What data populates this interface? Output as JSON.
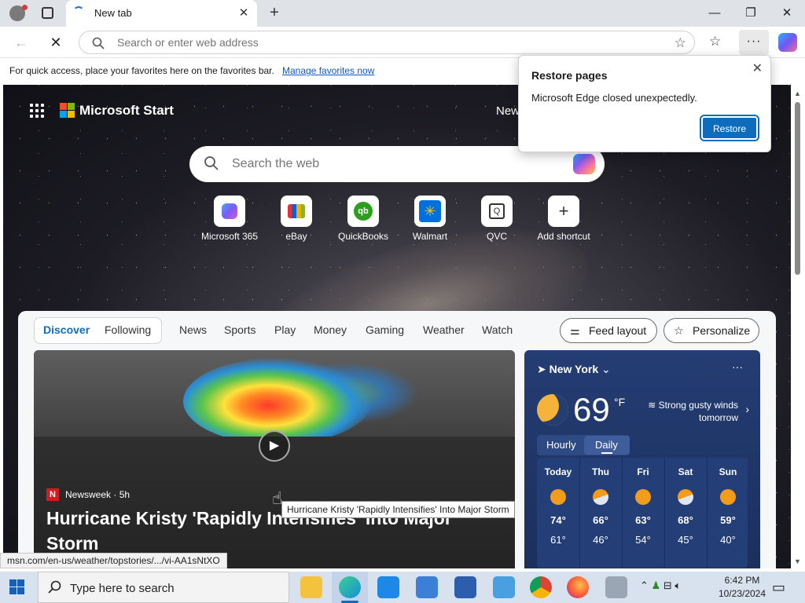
{
  "browser": {
    "tab_title": "New tab",
    "address_placeholder": "Search or enter web address",
    "favorites_hint": "For quick access, place your favorites here on the favorites bar.",
    "favorites_link": "Manage favorites now"
  },
  "start": {
    "brand": "Microsoft Start",
    "nav_partial": "New",
    "search_placeholder": "Search the web",
    "shortcuts": [
      {
        "label": "Microsoft 365",
        "icon": "microsoft-365-icon",
        "color": "#7b5cf5"
      },
      {
        "label": "eBay",
        "icon": "ebay-icon",
        "color": "#e53238"
      },
      {
        "label": "QuickBooks",
        "icon": "quickbooks-icon",
        "color": "#2ca01c"
      },
      {
        "label": "Walmart",
        "icon": "walmart-icon",
        "color": "#0071dc"
      },
      {
        "label": "QVC",
        "icon": "qvc-icon",
        "color": "#333333"
      },
      {
        "label": "Add shortcut",
        "icon": "plus-icon",
        "color": "#555555"
      }
    ]
  },
  "feed": {
    "tabs": [
      "Discover",
      "Following",
      "News",
      "Sports",
      "Play",
      "Money",
      "Gaming",
      "Weather",
      "Watch"
    ],
    "feed_layout_label": "Feed layout",
    "personalize_label": "Personalize",
    "hero": {
      "source": "Newsweek",
      "age": "· 5h",
      "headline": "Hurricane Kristy 'Rapidly Intensifies' Into Major Storm"
    }
  },
  "weather": {
    "location": "New York",
    "temperature": "69",
    "unit": "°F",
    "condition": "Strong gusty winds tomorrow",
    "tab_hourly": "Hourly",
    "tab_daily": "Daily",
    "days": [
      {
        "day": "Today",
        "hi": "74°",
        "lo": "61°",
        "icon": "sun-icon"
      },
      {
        "day": "Thu",
        "hi": "66°",
        "lo": "46°",
        "icon": "partly-cloudy-icon"
      },
      {
        "day": "Fri",
        "hi": "63°",
        "lo": "54°",
        "icon": "sun-icon"
      },
      {
        "day": "Sat",
        "hi": "68°",
        "lo": "45°",
        "icon": "partly-cloudy-icon"
      },
      {
        "day": "Sun",
        "hi": "59°",
        "lo": "40°",
        "icon": "sun-icon"
      }
    ]
  },
  "restore_popup": {
    "title": "Restore pages",
    "message": "Microsoft Edge closed unexpectedly.",
    "button": "Restore"
  },
  "tooltip": "Hurricane Kristy 'Rapidly Intensifies' Into Major Storm",
  "status_url": "msn.com/en-us/weather/topstories/.../vi-AA1sNtXO",
  "taskbar": {
    "search_placeholder": "Type here to search",
    "time": "6:42 PM",
    "date": "10/23/2024"
  }
}
